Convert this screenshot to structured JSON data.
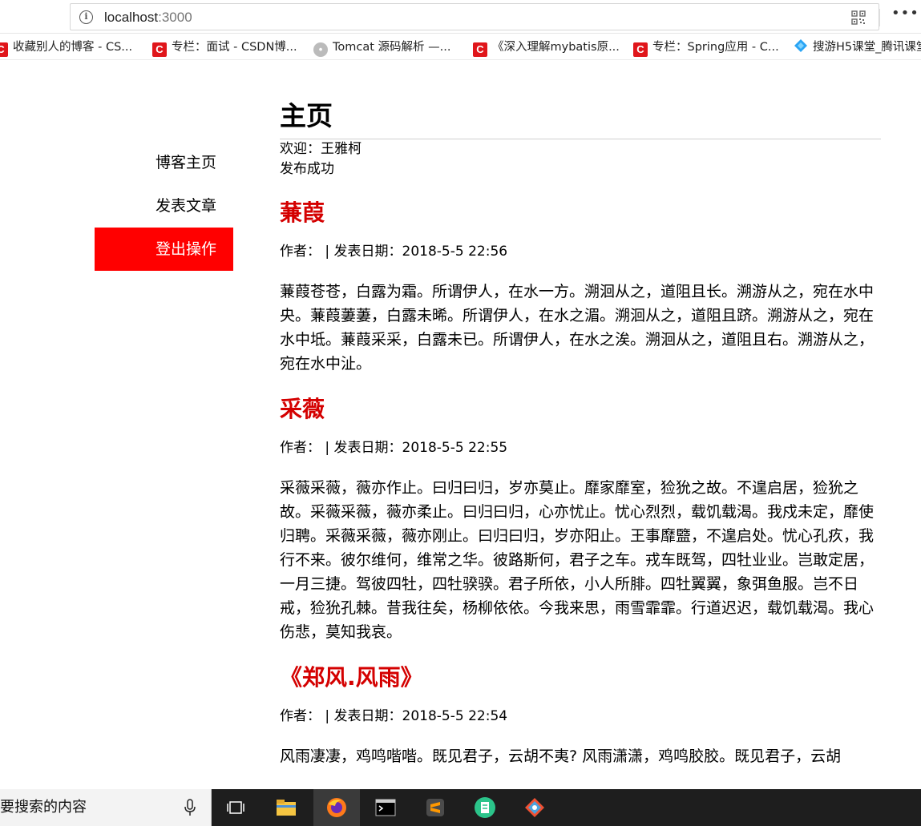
{
  "browser": {
    "url_host": "localhost",
    "url_port": ":3000",
    "bookmarks": [
      "收藏别人的博客 - CS...",
      "专栏：面试 - CSDN博...",
      "Tomcat 源码解析 —...",
      "《深入理解mybatis原...",
      "专栏：Spring应用 - C...",
      "搜游H5课堂_腾讯课堂"
    ]
  },
  "sidebar": {
    "items": [
      "博客主页",
      "发表文章",
      "登出操作"
    ]
  },
  "main": {
    "title": "主页",
    "welcome": "欢迎：王雅柯",
    "status": "发布成功",
    "articles": [
      {
        "title": "蒹葭",
        "meta": "作者：  | 发表日期：2018-5-5 22:56",
        "content": "蒹葭苍苍，白露为霜。所谓伊人，在水一方。溯洄从之，道阻且长。溯游从之，宛在水中央。蒹葭萋萋，白露未晞。所谓伊人，在水之湄。溯洄从之，道阻且跻。溯游从之，宛在水中坻。蒹葭采采，白露未已。所谓伊人，在水之涘。溯洄从之，道阻且右。溯游从之，宛在水中沚。"
      },
      {
        "title": "采薇",
        "meta": "作者：  | 发表日期：2018-5-5 22:55",
        "content": "采薇采薇，薇亦作止。曰归曰归，岁亦莫止。靡家靡室，猃狁之故。不遑启居，猃狁之故。采薇采薇，薇亦柔止。曰归曰归，心亦忧止。忧心烈烈，载饥载渴。我戍未定，靡使归聘。采薇采薇，薇亦刚止。曰归曰归，岁亦阳止。王事靡盬，不遑启处。忧心孔疚，我行不来。彼尔维何，维常之华。彼路斯何，君子之车。戎车既驾，四牡业业。岂敢定居，一月三捷。驾彼四牡，四牡骙骙。君子所依，小人所腓。四牡翼翼，象弭鱼服。岂不日戒，猃狁孔棘。昔我往矣，杨柳依依。今我来思，雨雪霏霏。行道迟迟，载饥载渴。我心伤悲，莫知我哀。"
      },
      {
        "title": "《郑风.风雨》",
        "meta": "作者：  | 发表日期：2018-5-5 22:54",
        "content": "风雨凄凄，鸡鸣喈喈。既见君子，云胡不夷? 风雨潇潇，鸡鸣胶胶。既见君子，云胡"
      }
    ]
  },
  "taskbar": {
    "search_text": "要搜索的内容"
  }
}
